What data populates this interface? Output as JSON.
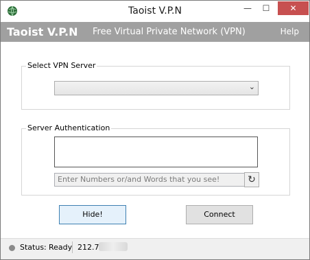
{
  "window": {
    "title": "Taoist V.P.N",
    "controls": {
      "minimize": "—",
      "maximize": "☐",
      "close": "✕"
    }
  },
  "header": {
    "brand": "Taoist V.P.N",
    "tagline": "Free Virtual Private Network (VPN)",
    "help": "Help"
  },
  "server_group": {
    "label": "Select VPN Server",
    "selected_value": "",
    "arrow": "⌄"
  },
  "auth_group": {
    "label": "Server Authentication",
    "captcha_placeholder": "Enter Numbers or/and Words that you see!",
    "refresh_glyph": "↻"
  },
  "buttons": {
    "hide": "Hide!",
    "connect": "Connect"
  },
  "status": {
    "label": "Status:",
    "value": "Ready",
    "ip": "212.7."
  },
  "colors": {
    "header_bg": "#a0a0a0",
    "close_bg": "#c75050",
    "accent_border": "#3c7fb1"
  }
}
